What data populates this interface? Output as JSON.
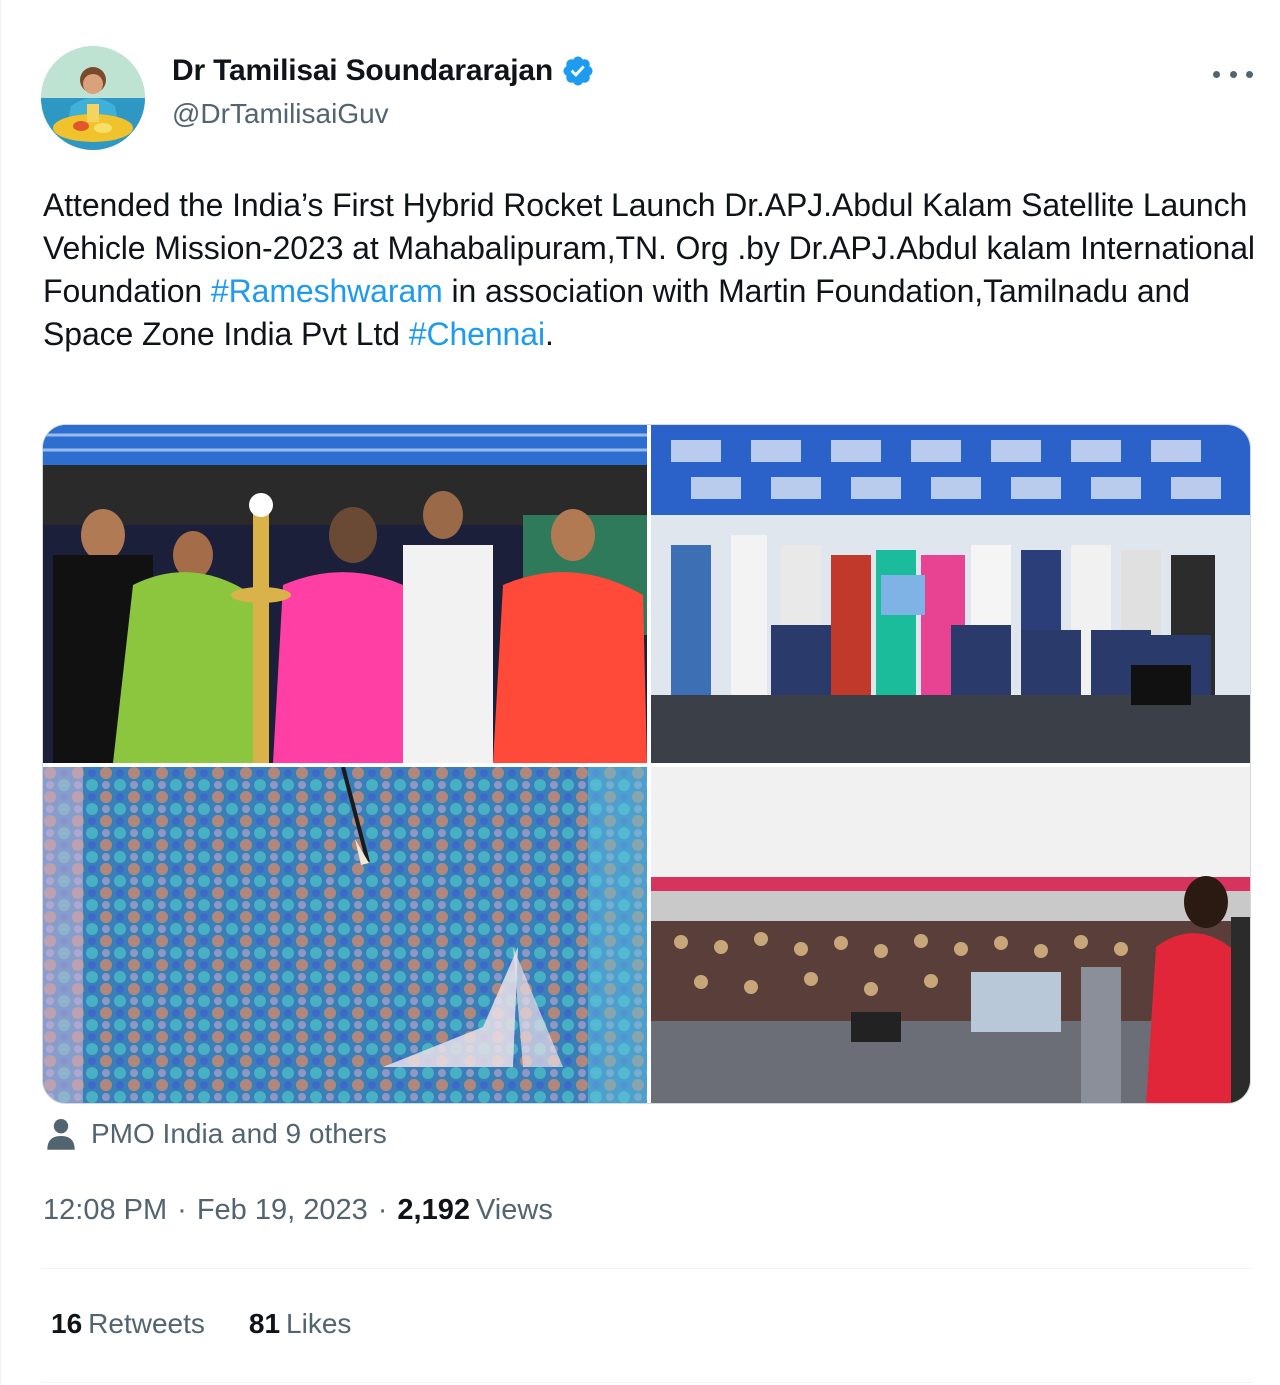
{
  "author": {
    "display_name": "Dr Tamilisai Soundararajan",
    "handle": "@DrTamilisaiGuv",
    "verified": true
  },
  "tweet": {
    "text_part1": "Attended the India’s First Hybrid Rocket Launch Dr.APJ.Abdul Kalam Satellite Launch Vehicle Mission-2023 at Mahabalipuram,TN. Org .by Dr.APJ.Abdul kalam International Foundation ",
    "hashtag1": "#Rameshwaram",
    "text_part2": " in association with Martin Foundation,Tamilnadu and Space Zone India Pvt Ltd ",
    "hashtag2": "#Chennai",
    "text_part3": "."
  },
  "media": {
    "photo_count": 4
  },
  "tagged": {
    "text": "PMO India and 9 others"
  },
  "meta": {
    "time": "12:08 PM",
    "separator": "·",
    "date": "Feb 19, 2023",
    "views_count": "2,192",
    "views_label": "Views"
  },
  "stats": {
    "retweets_count": "16",
    "retweets_label": "Retweets",
    "likes_count": "81",
    "likes_label": "Likes"
  },
  "colors": {
    "accent": "#1d9bf0",
    "text_primary": "#0f1419",
    "text_secondary": "#536471",
    "divider": "#eff3f4"
  },
  "icons": {
    "verified": "verified-badge-icon",
    "more": "more-icon",
    "tagged": "person-icon"
  }
}
